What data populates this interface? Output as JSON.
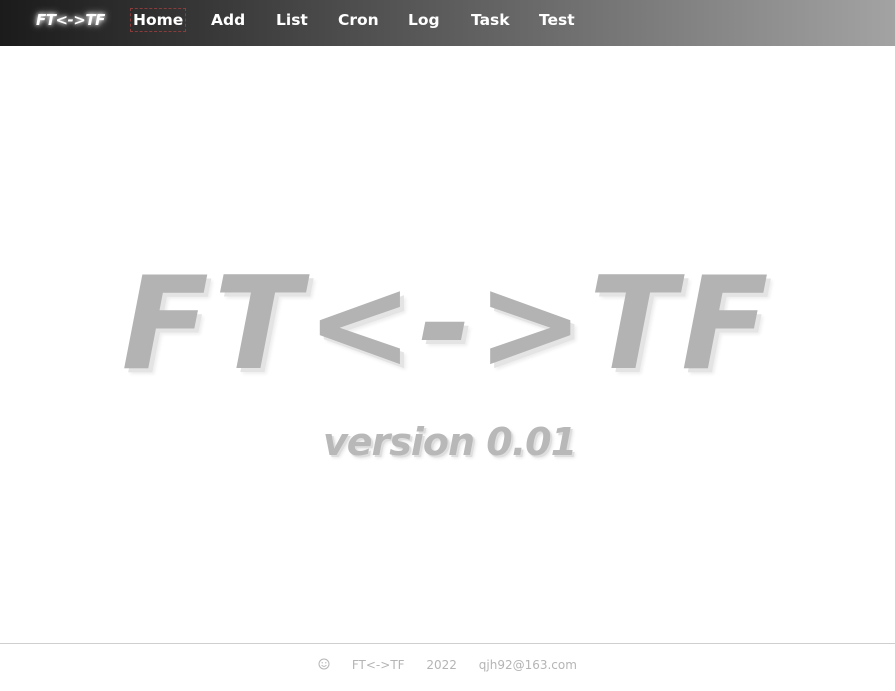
{
  "nav": {
    "brand": "FT<->TF",
    "items": [
      {
        "label": "Home",
        "active": true
      },
      {
        "label": "Add"
      },
      {
        "label": "List"
      },
      {
        "label": "Cron"
      },
      {
        "label": "Log"
      },
      {
        "label": "Task"
      },
      {
        "label": "Test"
      }
    ]
  },
  "hero": {
    "title": "FT<->TF",
    "version": "version 0.01"
  },
  "footer": {
    "icon": "smile-icon",
    "name": "FT<->TF",
    "year": "2022",
    "email": "qjh92@163.com"
  },
  "colors": {
    "nav_gradient_start": "#1b1b1b",
    "nav_gradient_end": "#a3a3a3",
    "hero_text": "#b3b3b3",
    "footer_text": "#b5b5b5"
  }
}
